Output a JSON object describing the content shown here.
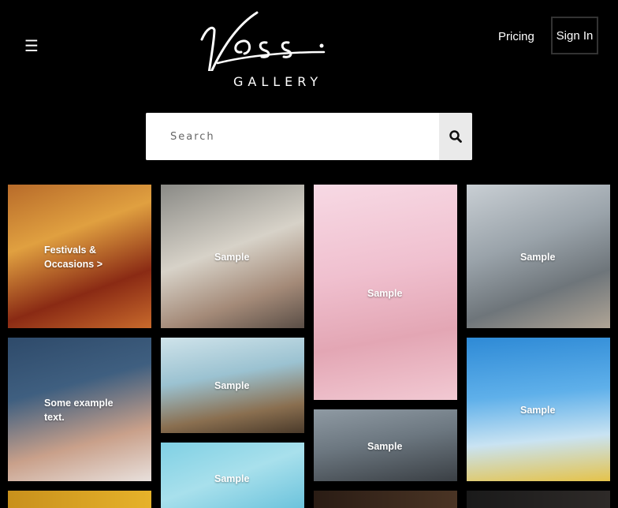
{
  "header": {
    "menu_glyph": "☰",
    "logo_word": "Voss",
    "logo_sub": "GALLERY",
    "pricing_label": "Pricing",
    "signin_label": "Sign In"
  },
  "search": {
    "placeholder": "Search"
  },
  "gallery": {
    "tiles": [
      {
        "label": "Festivals & Occasions >"
      },
      {
        "label": "Sample"
      },
      {
        "label": "Sample"
      },
      {
        "label": "Sample"
      },
      {
        "label": "Some example text."
      },
      {
        "label": "Sample"
      },
      {
        "label": "Sample"
      },
      {
        "label": "Sample"
      },
      {
        "label": "Sample"
      },
      {
        "label": ""
      },
      {
        "label": ""
      },
      {
        "label": ""
      }
    ]
  },
  "colors": {
    "background": "#000000",
    "text": "#ffffff",
    "search_button": "#eaeaea"
  }
}
